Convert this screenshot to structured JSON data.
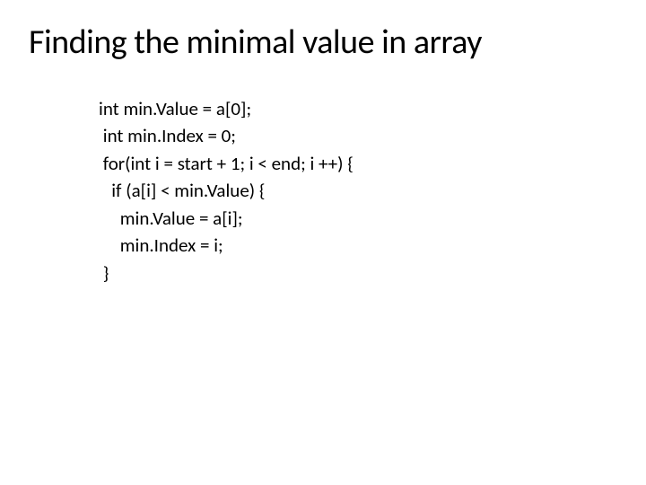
{
  "slide": {
    "title": "Finding the minimal value in array",
    "code": {
      "line1": "int min.Value = a[0];",
      "line2": " int min.Index = 0;",
      "line3": " for(int i = start + 1; i < end; i ++) {",
      "line4": "   if (a[i] < min.Value) {",
      "line5": "     min.Value = a[i];",
      "line6": "     min.Index = i;",
      "line7": " }"
    }
  }
}
